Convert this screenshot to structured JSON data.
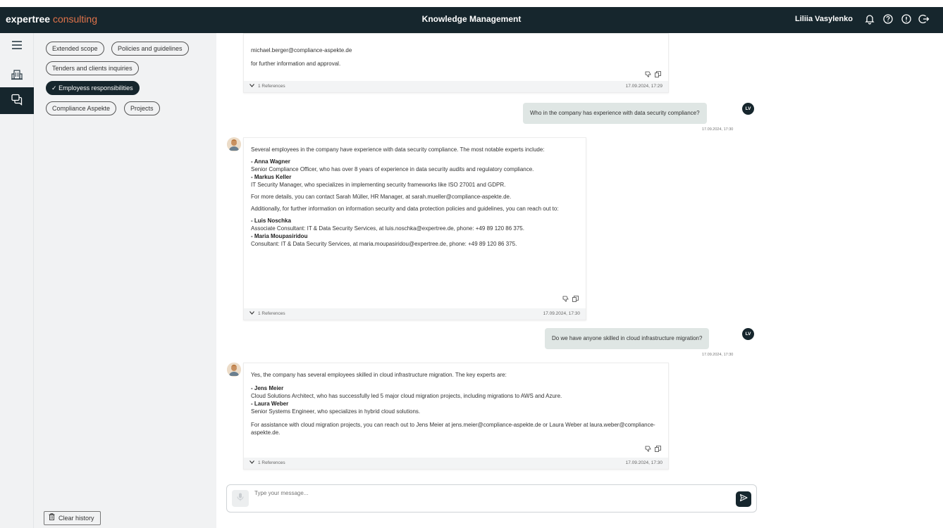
{
  "header": {
    "brand_part1": "expertree",
    "brand_part2": "consulting",
    "title": "Knowledge Management",
    "user_name": "Liliia Vasylenko",
    "bg_color": "#16262d",
    "accent_color": "#e0734a",
    "icons": [
      "bell-icon",
      "help-icon",
      "info-icon",
      "logout-icon"
    ]
  },
  "rail": {
    "items": [
      "menu-icon",
      "building-icon",
      "chat-icon"
    ],
    "active": "chat-icon"
  },
  "filters": {
    "chips": [
      {
        "label": "Extended scope",
        "selected": false
      },
      {
        "label": "Policies and guidelines",
        "selected": false
      },
      {
        "label": "Tenders and clients inquiries",
        "selected": false
      },
      {
        "label": "Employess responsibilities",
        "selected": true
      },
      {
        "label": "Compliance Aspekte",
        "selected": false
      },
      {
        "label": "Projects",
        "selected": false
      }
    ],
    "check_mark": "✓",
    "clear_history_label": "Clear history"
  },
  "chat": {
    "msg1": {
      "line1": "michael.berger@compliance-aspekte.de",
      "line2": "for further information and approval.",
      "references": "1 References",
      "time": "17.09.2024, 17:29"
    },
    "q1": {
      "text": "Who in the company has experience with data security compliance?",
      "initials": "LV",
      "time": "17.09.2024, 17:30"
    },
    "msg2": {
      "intro": "Several employees in the company have experience with data security compliance. The most notable experts include:",
      "p1_name": "- Anna Wagner",
      "p1_desc": "Senior Compliance Officer, who has over 8 years of experience in data security audits and regulatory compliance.",
      "p2_name": "- Markus Keller",
      "p2_desc": "IT Security Manager, who specializes in implementing security frameworks like ISO 27001 and GDPR.",
      "contact": "For more details, you can contact Sarah Müller, HR Manager, at sarah.mueller@compliance-aspekte.de.",
      "additional": "Additionally, for further information on information security and data protection policies and guidelines, you can reach out to:",
      "p3_name": "- Luis Noschka",
      "p3_desc": "Associate Consultant: IT & Data Security Services, at luis.noschka@expertree.de, phone: +49 89 120 86 375.",
      "p4_name": "- Maria Moupasiridou",
      "p4_desc": "Consultant: IT & Data Security Services, at maria.moupasiridou@expertree.de, phone: +49 89 120 86 375.",
      "references": "1 References",
      "time": "17.09.2024, 17:30"
    },
    "q2": {
      "text": "Do we have anyone skilled in cloud infrastructure migration?",
      "initials": "LV",
      "time": "17.09.2024, 17:30"
    },
    "msg3": {
      "intro": "Yes, the company has several employees skilled in cloud infrastructure migration. The key experts are:",
      "p1_name": "- Jens Meier",
      "p1_desc": "Cloud Solutions Architect, who has successfully led 5 major cloud migration projects, including migrations to AWS and Azure.",
      "p2_name": "- Laura Weber",
      "p2_desc": "Senior Systems Engineer, who specializes in hybrid cloud solutions.",
      "contact": "For assistance with cloud migration projects, you can reach out to Jens Meier at jens.meier@compliance-aspekte.de or Laura Weber at laura.weber@compliance-aspekte.de.",
      "references": "1 References",
      "time": "17.09.2024, 17:30"
    }
  },
  "composer": {
    "placeholder": "Type your message..."
  }
}
